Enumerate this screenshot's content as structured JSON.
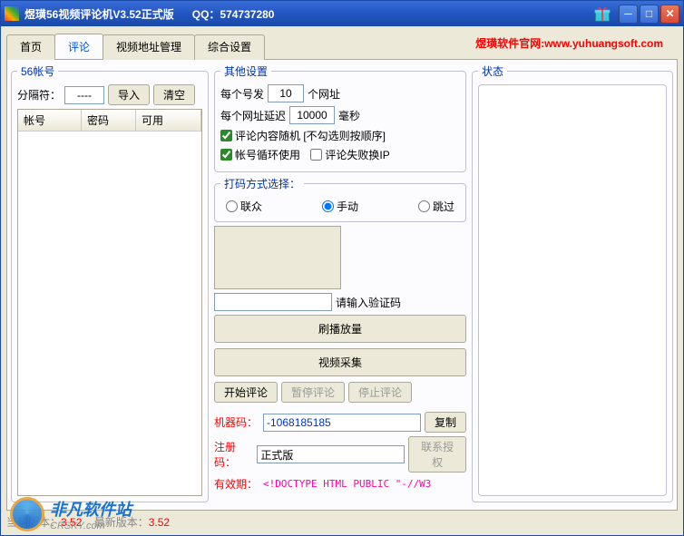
{
  "titlebar": {
    "title": "煜璜56视频评论机V3.52正式版",
    "qq_label": "QQ：574737280"
  },
  "header": {
    "site_label": "煜璜软件官网:",
    "site_url": "www.yuhuangsoft.com"
  },
  "tabs": {
    "home": "首页",
    "comment": "评论",
    "video_url_mgmt": "视频地址管理",
    "settings": "综合设置"
  },
  "left": {
    "legend": "56帐号",
    "sep_label": "分隔符：",
    "sep_value": "----",
    "import_btn": "导入",
    "clear_btn": "清空",
    "cols": {
      "account": "帐号",
      "password": "密码",
      "enabled": "可用"
    }
  },
  "mid": {
    "other_legend": "其他设置",
    "per_account_prefix": "每个号发",
    "per_account_value": "10",
    "per_account_suffix": "个网址",
    "delay_prefix": "每个网址延迟",
    "delay_value": "10000",
    "delay_suffix": "毫秒",
    "cb_random": "评论内容随机 [不勾选则按顺序]",
    "cb_loop": "帐号循环使用",
    "cb_failip": "评论失败换IP",
    "captcha_legend": "打码方式选择：",
    "radio_lianzhong": "联众",
    "radio_manual": "手动",
    "radio_skip": "跳过",
    "captcha_hint": "请输入验证码",
    "btn_brush": "刷播放量",
    "btn_collect": "视频采集",
    "btn_start": "开始评论",
    "btn_pause": "暂停评论",
    "btn_stop": "停止评论",
    "machine_label": "机器码：",
    "machine_value": "-1068185185",
    "copy_btn": "复制",
    "reg_label": "注册码：",
    "reg_value": "正式版",
    "contact_btn": "联系授权",
    "expire_label": "有效期：",
    "expire_value": "<!DOCTYPE HTML PUBLIC \"-//W3"
  },
  "right": {
    "legend": "状态"
  },
  "footer": {
    "cur_ver_label": "当前版本：",
    "cur_ver": "3.52",
    "latest_label": "最新版本：",
    "latest": "3.52"
  },
  "watermark": {
    "cn": "非凡软件站",
    "en": "CRSKY.com"
  }
}
